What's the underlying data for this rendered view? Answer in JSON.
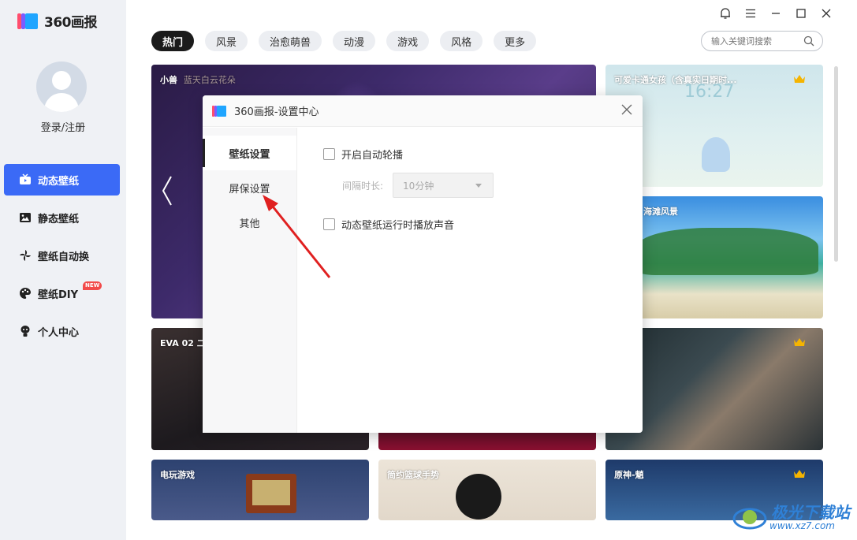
{
  "app": {
    "logo_text": "360画报"
  },
  "sidebar": {
    "login_label": "登录/注册",
    "items": [
      {
        "label": "动态壁纸",
        "icon": "tv-icon",
        "active": true
      },
      {
        "label": "静态壁纸",
        "icon": "image-icon",
        "active": false
      },
      {
        "label": "壁纸自动换",
        "icon": "pinwheel-icon",
        "active": false
      },
      {
        "label": "壁纸DIY",
        "icon": "palette-icon",
        "active": false,
        "badge": "NEW"
      },
      {
        "label": "个人中心",
        "icon": "user-icon",
        "active": false
      }
    ]
  },
  "tabs": [
    "热门",
    "风景",
    "治愈萌兽",
    "动漫",
    "游戏",
    "风格",
    "更多"
  ],
  "active_tab": "热门",
  "search": {
    "placeholder": "输入关键词搜索"
  },
  "cards": {
    "featured": {
      "label": "小兽",
      "sub": "蓝天白云花朵"
    },
    "top_right": {
      "label": "可爱卡通女孩（含真实日期时...",
      "clock": "16:27"
    },
    "beach": {
      "label": "海滩风景"
    },
    "eva": {
      "label": "EVA 02 二"
    },
    "game": {
      "label": "电玩游戏"
    },
    "basketball": {
      "label": "简约篮球手势"
    },
    "genshin": {
      "label": "原神-魈"
    }
  },
  "dialog": {
    "title": "360画报-设置中心",
    "side_items": [
      "壁纸设置",
      "屏保设置",
      "其他"
    ],
    "active_side": "壁纸设置",
    "auto_rotate_label": "开启自动轮播",
    "interval_label": "间隔时长:",
    "interval_value": "10分钟",
    "sound_label": "动态壁纸运行时播放声音"
  },
  "watermark": {
    "line1": "极光下载站",
    "line2": "www.xz7.com"
  },
  "colors": {
    "accent": "#3b6af6",
    "badge": "#f24a4a",
    "annotation": "#e02020"
  }
}
